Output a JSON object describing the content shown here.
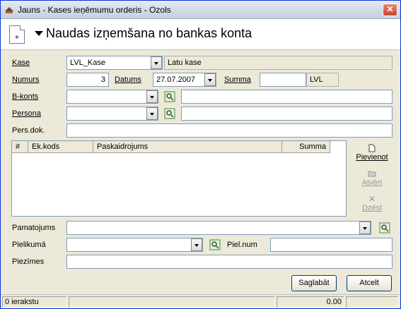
{
  "window": {
    "title": "Jauns - Kases ieņēmumu orderis - Ozols",
    "close_label": "✕"
  },
  "header": {
    "title": "Naudas izņemšana no bankas konta"
  },
  "form": {
    "kase_label": "Kase",
    "kase_value": "LVL_Kase",
    "kase_name": "Latu kase",
    "numurs_label": "Numurs",
    "numurs_value": "3",
    "datums_label": "Datums",
    "datums_value": "27.07.2007",
    "summa_label": "Summa",
    "summa_value": "",
    "currency": "LVL",
    "bkonts_label": "B-konts",
    "bkonts_value": "",
    "bkonts_name": "",
    "persona_label": "Persona",
    "persona_value": "",
    "persona_name": "",
    "persdok_label": "Pers.dok.",
    "persdok_value": "",
    "pamatojums_label": "Pamatojums",
    "pamatojums_value": "",
    "pielikuma_label": "Pielikumā",
    "pielikuma_value": "",
    "pielnum_label": "Piel.num",
    "pielnum_value": "",
    "piezimes_label": "Piezīmes",
    "piezimes_value": ""
  },
  "grid": {
    "columns": [
      "#",
      "Ek.kods",
      "Paskaidrojums",
      "Summa"
    ],
    "rows": []
  },
  "side_buttons": {
    "add": "Pievienot",
    "open": "Atvērt",
    "delete": "Dzēst"
  },
  "buttons": {
    "save": "Saglabāt",
    "cancel": "Atcelt"
  },
  "status": {
    "records": "0 ierakstu",
    "total": "0.00"
  },
  "colors": {
    "titlebar_border": "#0831d9",
    "window_bg": "#ece9d8",
    "close": "#c8442e",
    "field_border": "#7f9db9"
  }
}
